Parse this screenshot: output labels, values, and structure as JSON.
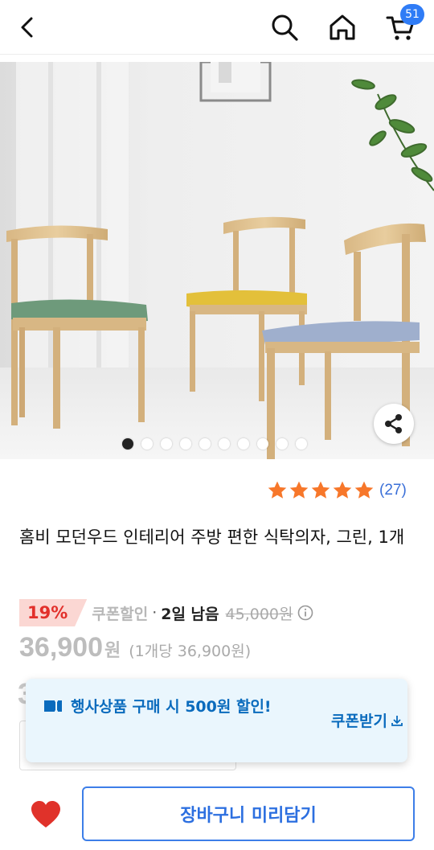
{
  "header": {
    "back_icon": "chevron-left-icon",
    "search_icon": "search-icon",
    "home_icon": "home-icon",
    "cart_icon": "cart-icon",
    "cart_count": "51"
  },
  "gallery": {
    "total_images": 10,
    "current_index": 1,
    "share_icon": "share-icon"
  },
  "rating": {
    "stars": 5,
    "count_text": "(27)",
    "star_color": "#f7772a"
  },
  "product": {
    "title": "홈비 모던우드 인테리어 주방 편한 식탁의자, 그린, 1개"
  },
  "pricing": {
    "discount_pct": "19%",
    "coupon_label": "쿠폰할인",
    "separator": "·",
    "days_left": "2일 남음",
    "original_price": "45,000원",
    "sale_price": "36,900",
    "currency": "원",
    "unit_price": "(1개당 36,900원)"
  },
  "peek": {
    "digit": "3"
  },
  "coupon_popup": {
    "message": "행사상품 구매 시 500원 할인!",
    "button_label": "쿠폰받기",
    "accent_color": "#0a6bbd"
  },
  "bottom_bar": {
    "wishlist_icon": "heart-icon",
    "cart_button_label": "장바구니 미리담기",
    "heart_color": "#e0322a"
  }
}
